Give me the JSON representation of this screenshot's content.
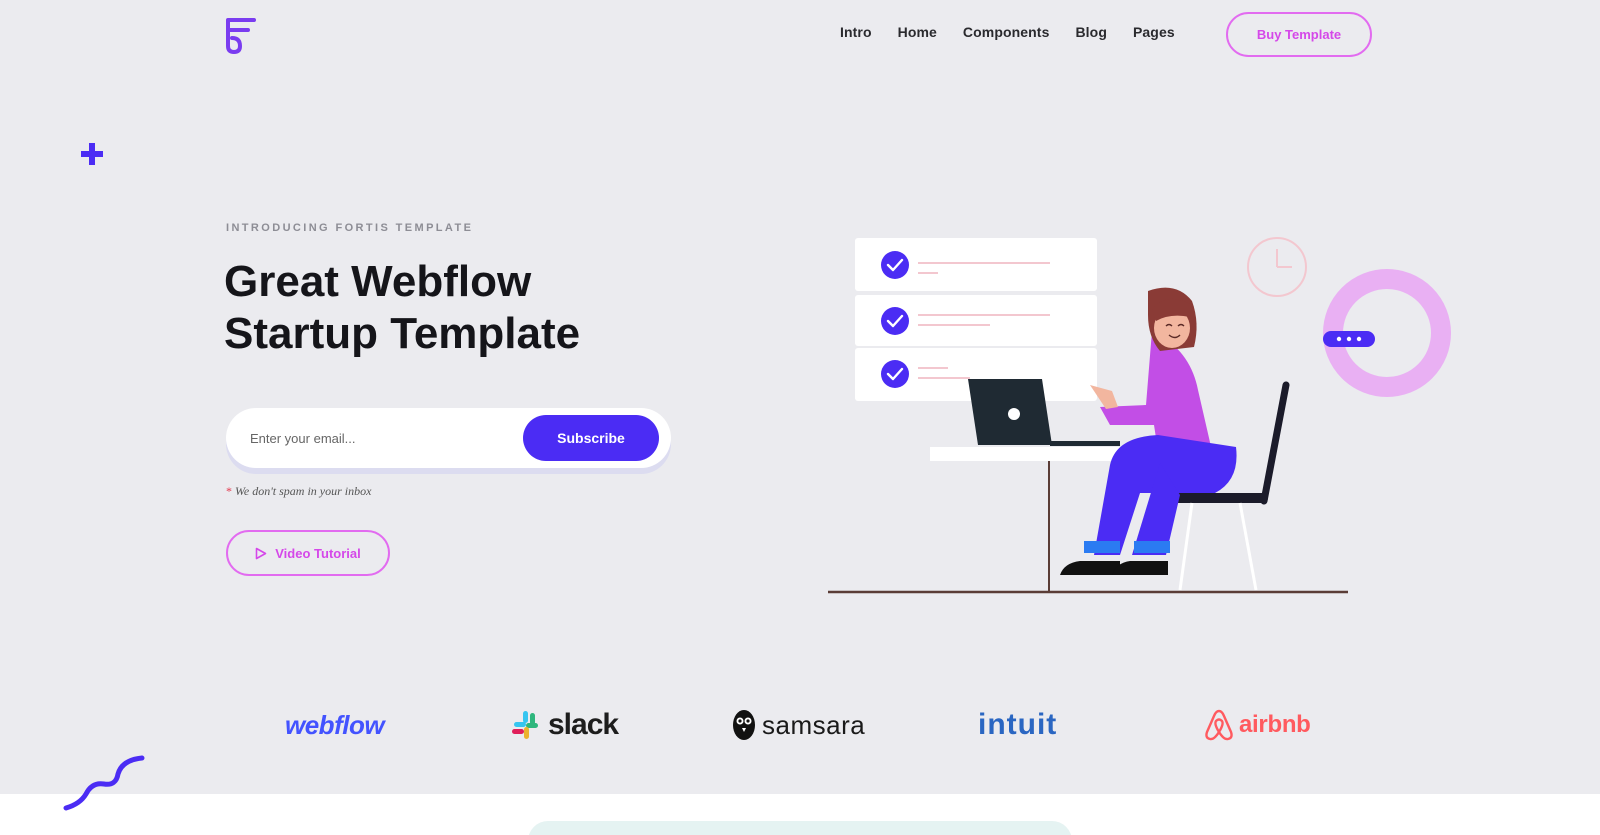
{
  "nav": {
    "items": [
      "Intro",
      "Home",
      "Components",
      "Blog",
      "Pages"
    ],
    "buy_label": "Buy Template"
  },
  "hero": {
    "eyebrow": "INTRODUCING FORTIS TEMPLATE",
    "headline_line1": "Great Webflow",
    "headline_line2": "Startup Template",
    "email_placeholder": "Enter your email...",
    "subscribe_label": "Subscribe",
    "nospam_star": "*",
    "nospam_text": "We don't spam in your inbox",
    "video_label": "Video Tutorial"
  },
  "logos": {
    "webflow": "webflow",
    "slack": "slack",
    "samsara": "samsara",
    "intuit": "intuit",
    "airbnb": "airbnb"
  },
  "colors": {
    "background": "#ebebef",
    "accent": "#4b2cf4",
    "pink": "#e26bf0",
    "text": "#15151a"
  }
}
